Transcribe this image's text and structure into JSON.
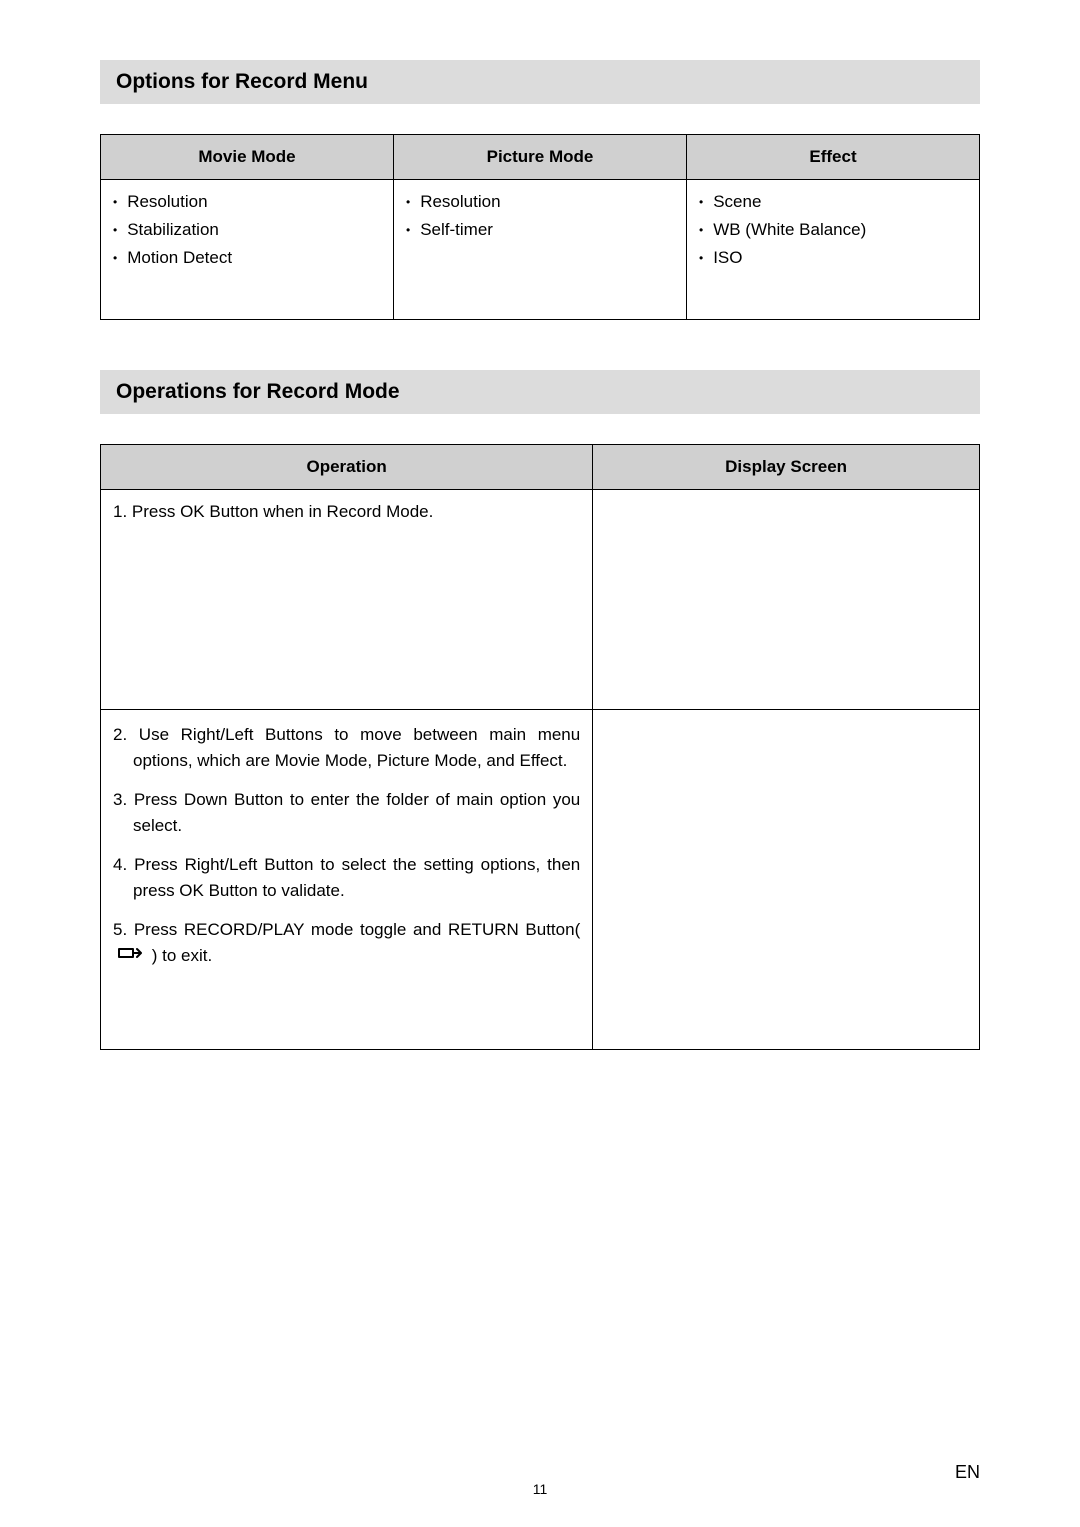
{
  "section1": {
    "title": "Options for Record Menu",
    "headers": [
      "Movie Mode",
      "Picture Mode",
      "Effect"
    ],
    "col1": [
      "Resolution",
      "Stabilization",
      "Motion Detect"
    ],
    "col2": [
      "Resolution",
      "Self-timer"
    ],
    "col3": [
      "Scene",
      "WB (White Balance)",
      "ISO"
    ]
  },
  "section2": {
    "title": "Operations for Record Mode",
    "headers": [
      "Operation",
      "Display Screen"
    ],
    "row1": "1. Press OK Button when in Record Mode.",
    "row2": {
      "item2": "2. Use Right/Left Buttons to move between main menu options, which are Movie Mode, Picture Mode, and Effect.",
      "item3": "3. Press Down Button to enter the folder of main option you select.",
      "item4": "4. Press Right/Left Button to select the setting options, then press OK Button to validate.",
      "item5_a": "5. Press RECORD/PLAY mode toggle and RETURN Button(",
      "item5_b": ") to exit."
    }
  },
  "footer": {
    "pageNumber": "11",
    "lang": "EN"
  }
}
